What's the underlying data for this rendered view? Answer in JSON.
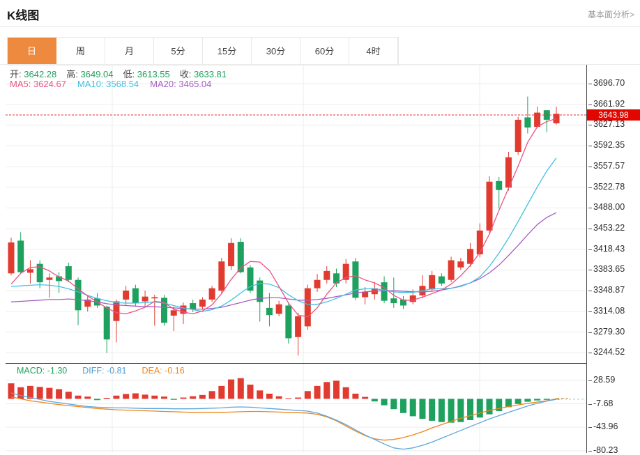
{
  "header": {
    "title": "K线图",
    "link": "基本面分析>"
  },
  "tabs": {
    "items": [
      {
        "label": "日",
        "active": true
      },
      {
        "label": "周",
        "active": false
      },
      {
        "label": "月",
        "active": false
      },
      {
        "label": "5分",
        "active": false
      },
      {
        "label": "15分",
        "active": false
      },
      {
        "label": "30分",
        "active": false
      },
      {
        "label": "60分",
        "active": false
      },
      {
        "label": "4时",
        "active": false
      }
    ]
  },
  "main": {
    "ohlc": [
      {
        "label": "开:",
        "value": "3642.28"
      },
      {
        "label": "高:",
        "value": "3649.04"
      },
      {
        "label": "低:",
        "value": "3613.55"
      },
      {
        "label": "收:",
        "value": "3633.81"
      }
    ],
    "ma": [
      {
        "label": "MA5:",
        "value": "3624.67",
        "color": "#ec5380"
      },
      {
        "label": "MA10:",
        "value": "3568.54",
        "color": "#42c0e0"
      },
      {
        "label": "MA20:",
        "value": "3465.04",
        "color": "#a85cc5"
      }
    ],
    "last_price": "3643.98"
  },
  "macd_panel": {
    "labels": [
      {
        "label": "MACD:",
        "value": "-1.30",
        "color": "#21a05c"
      },
      {
        "label": "DIFF:",
        "value": "-0.81",
        "color": "#4d9bd5"
      },
      {
        "label": "DEA:",
        "value": "-0.16",
        "color": "#f0851b"
      }
    ]
  },
  "chart_data": {
    "type": "candlestick",
    "title": "K线图",
    "interval_selected": "日",
    "legend": [
      "MA5",
      "MA10",
      "MA20"
    ],
    "grid": true,
    "y_axis_side": "right",
    "current_price": 3643.98,
    "y_ticks": [
      "3696.70",
      "3661.92",
      "3627.13",
      "3592.35",
      "3557.57",
      "3522.78",
      "3488.00",
      "3453.22",
      "3418.43",
      "3383.65",
      "3348.87",
      "3314.08",
      "3279.30",
      "3244.52"
    ],
    "ylim": [
      3230,
      3710
    ],
    "candles_ochl": [
      [
        3378,
        3430,
        3438,
        3375
      ],
      [
        3433,
        3380,
        3447,
        3378
      ],
      [
        3379,
        3385,
        3400,
        3361
      ],
      [
        3394,
        3363,
        3400,
        3353
      ],
      [
        3367,
        3371,
        3378,
        3337
      ],
      [
        3373,
        3365,
        3380,
        3345
      ],
      [
        3390,
        3367,
        3396,
        3363
      ],
      [
        3367,
        3316,
        3371,
        3291
      ],
      [
        3322,
        3334,
        3341,
        3314
      ],
      [
        3336,
        3324,
        3345,
        3320
      ],
      [
        3322,
        3267,
        3324,
        3244
      ],
      [
        3298,
        3331,
        3334,
        3262
      ],
      [
        3334,
        3349,
        3357,
        3325
      ],
      [
        3353,
        3328,
        3359,
        3322
      ],
      [
        3331,
        3339,
        3349,
        3322
      ],
      [
        3336,
        3338,
        3342,
        3290
      ],
      [
        3337,
        3295,
        3342,
        3290
      ],
      [
        3307,
        3316,
        3322,
        3281
      ],
      [
        3310,
        3324,
        3329,
        3293
      ],
      [
        3328,
        3318,
        3334,
        3313
      ],
      [
        3322,
        3334,
        3338,
        3317
      ],
      [
        3334,
        3353,
        3357,
        3330
      ],
      [
        3349,
        3398,
        3404,
        3345
      ],
      [
        3390,
        3429,
        3437,
        3384
      ],
      [
        3431,
        3380,
        3437,
        3378
      ],
      [
        3388,
        3349,
        3392,
        3345
      ],
      [
        3366,
        3330,
        3371,
        3297
      ],
      [
        3320,
        3308,
        3345,
        3289
      ],
      [
        3310,
        3326,
        3332,
        3306
      ],
      [
        3324,
        3269,
        3328,
        3260
      ],
      [
        3271,
        3306,
        3312,
        3240
      ],
      [
        3289,
        3353,
        3359,
        3283
      ],
      [
        3353,
        3367,
        3377,
        3347
      ],
      [
        3367,
        3382,
        3390,
        3361
      ],
      [
        3378,
        3361,
        3386,
        3355
      ],
      [
        3367,
        3394,
        3402,
        3361
      ],
      [
        3398,
        3337,
        3404,
        3333
      ],
      [
        3338,
        3347,
        3355,
        3326
      ],
      [
        3343,
        3353,
        3363,
        3334
      ],
      [
        3363,
        3332,
        3373,
        3328
      ],
      [
        3336,
        3328,
        3371,
        3320
      ],
      [
        3334,
        3324,
        3340,
        3318
      ],
      [
        3330,
        3341,
        3351,
        3326
      ],
      [
        3341,
        3357,
        3375,
        3336
      ],
      [
        3351,
        3375,
        3382,
        3347
      ],
      [
        3373,
        3361,
        3378,
        3357
      ],
      [
        3367,
        3400,
        3406,
        3363
      ],
      [
        3388,
        3398,
        3404,
        3384
      ],
      [
        3394,
        3419,
        3429,
        3389
      ],
      [
        3410,
        3450,
        3462,
        3405
      ],
      [
        3450,
        3532,
        3541,
        3445
      ],
      [
        3533,
        3518,
        3540,
        3487
      ],
      [
        3522,
        3573,
        3582,
        3517
      ],
      [
        3582,
        3636,
        3641,
        3577
      ],
      [
        3640,
        3623,
        3675,
        3613
      ],
      [
        3624,
        3648,
        3658,
        3622
      ],
      [
        3652,
        3636,
        3652,
        3615
      ],
      [
        3630,
        3646,
        3658,
        3628
      ]
    ],
    "ma5": [
      3360,
      3378,
      3388,
      3389,
      3382,
      3372,
      3365,
      3352,
      3340,
      3330,
      3320,
      3312,
      3310,
      3315,
      3321,
      3331,
      3329,
      3318,
      3313,
      3310,
      3315,
      3325,
      3344,
      3368,
      3387,
      3398,
      3397,
      3383,
      3356,
      3328,
      3308,
      3305,
      3320,
      3343,
      3362,
      3371,
      3374,
      3367,
      3362,
      3354,
      3341,
      3333,
      3333,
      3338,
      3344,
      3350,
      3360,
      3374,
      3391,
      3413,
      3444,
      3484,
      3521,
      3558,
      3598,
      3624,
      3633,
      3638
    ],
    "ma10": [
      3356,
      3357,
      3358,
      3359,
      3358,
      3356,
      3352,
      3347,
      3341,
      3336,
      3332,
      3329,
      3328,
      3328,
      3329,
      3330,
      3328,
      3324,
      3320,
      3317,
      3314,
      3317,
      3323,
      3333,
      3345,
      3356,
      3361,
      3360,
      3354,
      3342,
      3332,
      3326,
      3326,
      3330,
      3336,
      3343,
      3350,
      3352,
      3352,
      3350,
      3347,
      3346,
      3346,
      3349,
      3352,
      3352,
      3353,
      3356,
      3362,
      3372,
      3390,
      3412,
      3437,
      3465,
      3494,
      3523,
      3550,
      3572
    ],
    "ma20": [
      3330,
      3331,
      3332,
      3333,
      3334,
      3334,
      3335,
      3334,
      3332,
      3330,
      3327,
      3325,
      3324,
      3323,
      3322,
      3322,
      3321,
      3320,
      3319,
      3318,
      3318,
      3319,
      3321,
      3325,
      3329,
      3333,
      3336,
      3337,
      3337,
      3335,
      3333,
      3333,
      3334,
      3336,
      3339,
      3342,
      3345,
      3347,
      3348,
      3349,
      3349,
      3348,
      3347,
      3347,
      3348,
      3350,
      3353,
      3357,
      3362,
      3369,
      3379,
      3392,
      3408,
      3425,
      3443,
      3460,
      3472,
      3480
    ],
    "macd": {
      "y_ticks": [
        "28.59",
        "-7.68",
        "-43.96",
        "-80.23"
      ],
      "macd_value": -1.3,
      "diff_value": -0.81,
      "dea_value": -0.16,
      "histogram": [
        24,
        18,
        20,
        18.5,
        17,
        15,
        11,
        5,
        3.5,
        -2,
        1.5,
        5,
        7.5,
        8.5,
        6.5,
        5,
        3.5,
        -1.5,
        2,
        4,
        6,
        12,
        20,
        30,
        32,
        22,
        13,
        8,
        4,
        1,
        2,
        12,
        20,
        26,
        28,
        18,
        8,
        3,
        -4,
        -10,
        -16,
        -22,
        -27,
        -31,
        -34,
        -36,
        -37,
        -36,
        -33,
        -29,
        -24,
        -19,
        -13,
        -8,
        -4.5,
        -2.5,
        -1.6,
        -1.3
      ],
      "diff": [
        9,
        5,
        2,
        -1,
        -4,
        -6,
        -8,
        -10,
        -12,
        -13,
        -13.5,
        -14,
        -14,
        -14.5,
        -15,
        -15,
        -15,
        -15.5,
        -15.5,
        -15.5,
        -15,
        -14.5,
        -14,
        -13,
        -12.5,
        -13,
        -14,
        -15,
        -16,
        -17,
        -18,
        -19,
        -22,
        -27,
        -33,
        -40,
        -48,
        -56,
        -63,
        -70,
        -76,
        -78,
        -76,
        -72,
        -67,
        -61,
        -55,
        -49,
        -43,
        -37,
        -31,
        -26,
        -21,
        -16,
        -11,
        -7,
        -3.5,
        -0.81
      ],
      "dea": [
        3,
        0,
        -3,
        -5,
        -7,
        -9,
        -10.5,
        -12,
        -13.5,
        -15,
        -16,
        -17,
        -17.5,
        -18,
        -18.5,
        -19,
        -19.5,
        -20,
        -20.5,
        -21,
        -21,
        -21,
        -21,
        -20.5,
        -20,
        -19.5,
        -19.5,
        -20,
        -20.5,
        -21,
        -21.5,
        -22,
        -24,
        -28,
        -34,
        -42,
        -50,
        -57,
        -62,
        -64,
        -63,
        -60,
        -56,
        -51,
        -45,
        -40,
        -35,
        -30,
        -26,
        -22,
        -18,
        -15,
        -12,
        -9.5,
        -7,
        -5,
        -3,
        -0.16
      ]
    },
    "colors": {
      "up": "#e13b30",
      "down": "#1ea15f",
      "ma5": "#ec5380",
      "ma10": "#42c0e0",
      "ma20": "#a85cc5",
      "diff_line": "#5aa7dc",
      "dea_line": "#f0851b",
      "price_line": "#e63030",
      "badge_bg": "#e10600",
      "tab_active_bg": "#ed8a3f",
      "grid": "#ededed",
      "value_text": "#1fa05c"
    }
  }
}
